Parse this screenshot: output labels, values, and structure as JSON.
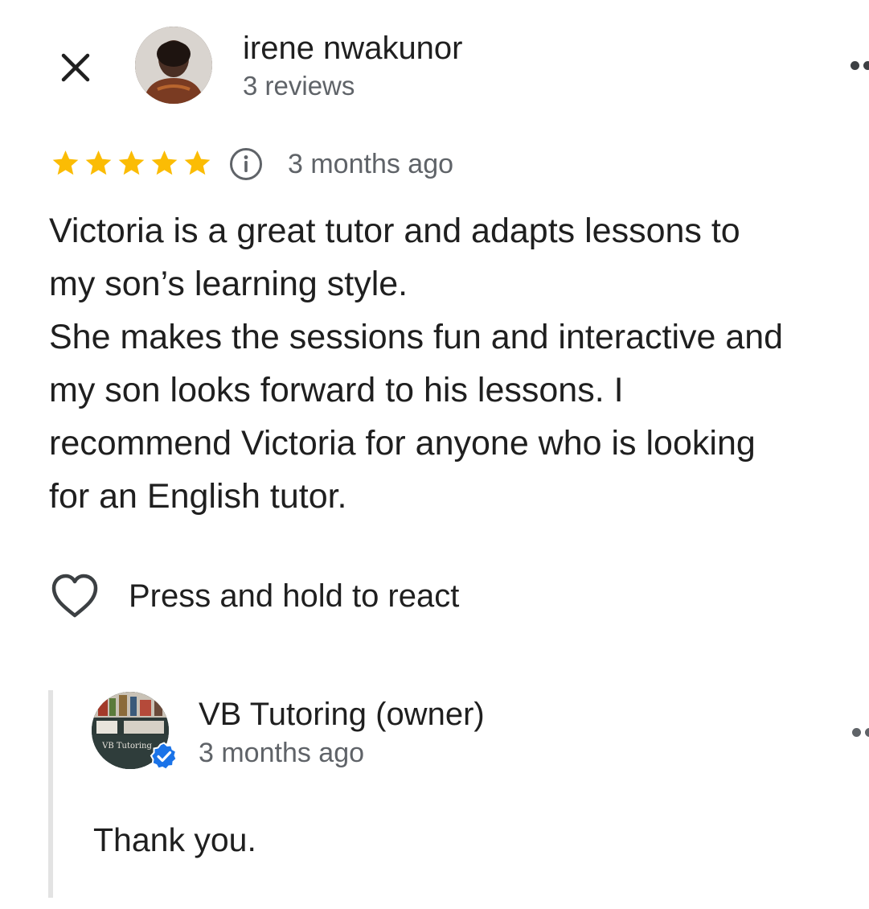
{
  "header": {
    "close_icon": "close-icon",
    "reviewer_name": "irene nwakunor",
    "reviewer_meta": "3 reviews",
    "more_icon": "more-options-icon"
  },
  "rating": {
    "stars": 5,
    "max_stars": 5,
    "star_color": "#fbbc04",
    "info_icon": "info-icon",
    "date": "3 months ago"
  },
  "review": {
    "text": "Victoria is a great tutor and adapts lessons to\nmy son’s learning style.\nShe makes the sessions fun and interactive and\nmy son looks forward to his lessons. I\nrecommend Victoria for anyone who is looking\nfor an English  tutor."
  },
  "react": {
    "icon": "heart-outline-icon",
    "label": "Press and hold to react"
  },
  "owner_reply": {
    "avatar_text": "VB Tutoring",
    "name": "VB Tutoring (owner)",
    "date": "3 months ago",
    "text": "Thank you.",
    "verified_icon": "verified-badge-icon",
    "verified_color": "#1a73e8"
  },
  "colors": {
    "text_primary": "#1f1f1f",
    "text_secondary": "#5f6368",
    "reply_bar": "#e3e3e3"
  }
}
